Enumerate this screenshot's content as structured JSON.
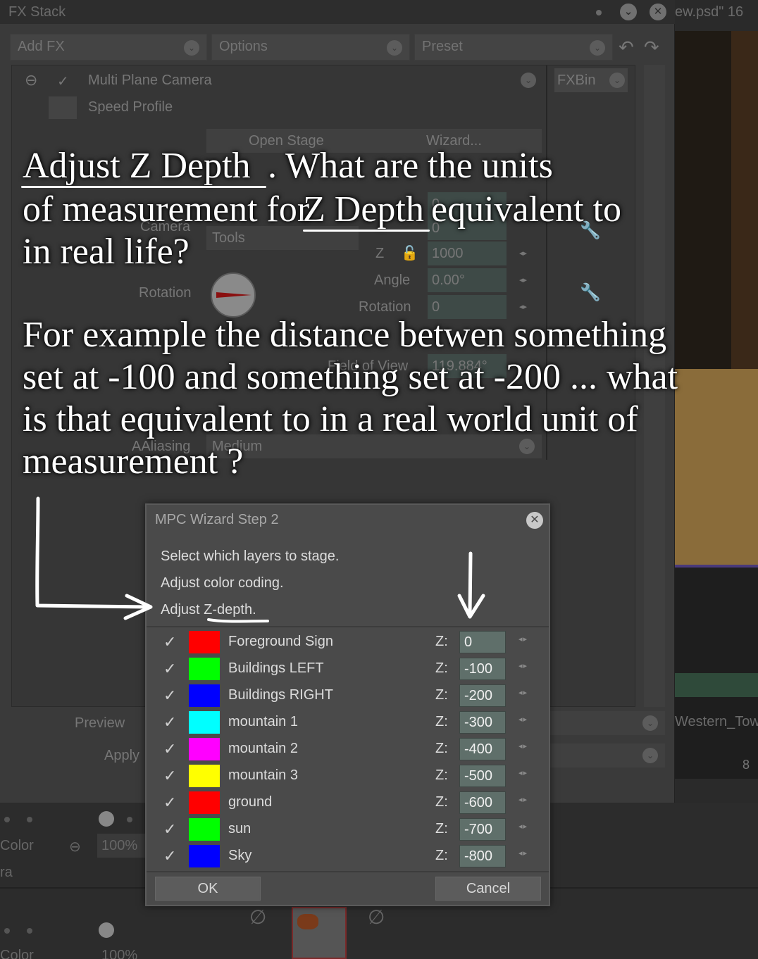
{
  "fx_stack": {
    "title": "FX Stack",
    "close_symbol": "✕",
    "chev_symbol": "⌄",
    "add_fx_label": "Add FX",
    "options_label": "Options",
    "preset_label": "Preset",
    "fxbin_label": "FXBin",
    "effect_name": "Multi Plane Camera",
    "effect_sub": "Speed Profile",
    "open_stage_label": "Open Stage",
    "wizard_label": "Wizard...",
    "camera_label": "Camera",
    "tools_label": "Tools",
    "z_label": "Z",
    "z_value": "1000",
    "angle_label": "Angle",
    "angle_value": "0.00°",
    "rotation_label": "Rotation",
    "rotation_value": "0",
    "rotation_dial_label": "Rotation",
    "fov_label": "Field of View",
    "fov_value": "119.884°",
    "aaliasing_label": "AAliasing",
    "aaliasing_value": "Medium",
    "preview_label": "Preview",
    "apply_label": "Apply",
    "zero_value": "0"
  },
  "side": {
    "title": "ew.psd\"   16",
    "layer_label": "Western_Tow",
    "count": "8"
  },
  "bottom": {
    "color_label": "Color",
    "percent": "100%",
    "ra_label": "ra",
    "ban_symbol": "∅"
  },
  "question": {
    "line1a": "Adjust  Z  Depth",
    "line1b": " . What are the units",
    "line2a": "of measurement for ",
    "line2b": "Z Depth",
    "line2c": " equivalent to",
    "line3": " in real life?",
    "line4": "For example the distance betwen something",
    "line5": "set at  -100 and something set at -200 ... what",
    "line6": "is that equivalent to in a real world unit of",
    "line7": "measurement ?"
  },
  "dialog": {
    "title": "MPC Wizard Step 2",
    "close_symbol": "✕",
    "instructions": [
      "Select which layers to stage.",
      "Adjust color coding.",
      "Adjust Z-depth."
    ],
    "check_symbol": "✓",
    "spin_symbol": "◂▸",
    "z_label": "Z:",
    "layers": [
      {
        "name": "Foreground Sign",
        "color": "#ff0000",
        "z": "0"
      },
      {
        "name": "Buildings LEFT",
        "color": "#00ff00",
        "z": "-100"
      },
      {
        "name": "Buildings RIGHT",
        "color": "#0000ff",
        "z": "-200"
      },
      {
        "name": "mountain 1",
        "color": "#00ffff",
        "z": "-300"
      },
      {
        "name": "mountain 2",
        "color": "#ff00ff",
        "z": "-400"
      },
      {
        "name": "mountain 3",
        "color": "#ffff00",
        "z": "-500"
      },
      {
        "name": "ground",
        "color": "#ff0000",
        "z": "-600"
      },
      {
        "name": "sun",
        "color": "#00ff00",
        "z": "-700"
      },
      {
        "name": "Sky",
        "color": "#0000ff",
        "z": "-800"
      }
    ],
    "ok_label": "OK",
    "cancel_label": "Cancel"
  }
}
